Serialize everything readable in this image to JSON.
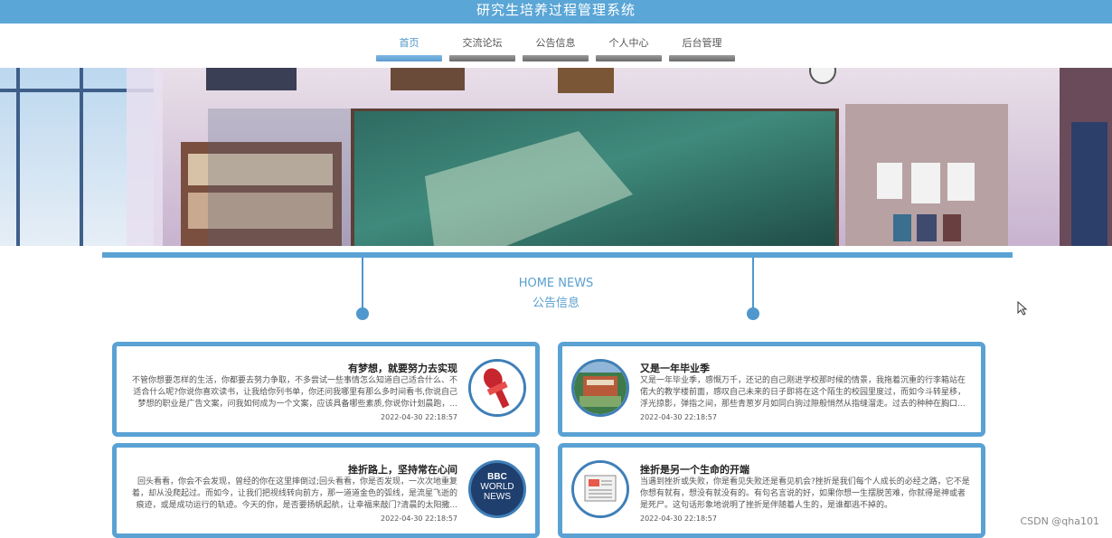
{
  "app": {
    "title": "研究生培养过程管理系统"
  },
  "nav": {
    "items": [
      {
        "label": "首页",
        "active": true
      },
      {
        "label": "交流论坛",
        "active": false
      },
      {
        "label": "公告信息",
        "active": false
      },
      {
        "label": "个人中心",
        "active": false
      },
      {
        "label": "后台管理",
        "active": false
      }
    ]
  },
  "section": {
    "title_en": "HOME NEWS",
    "title_cn": "公告信息"
  },
  "news": [
    {
      "title": "有梦想，就要努力去实现",
      "desc": "不管你想要怎样的生活，你都要去努力争取，不多尝试一些事情怎么知道自己适合什么、不适合什么呢?你说你喜欢读书，让我给你列书单，你还问我哪里有那么多时间看书,你说自己梦想的职业是广告文案，问我如何成为一个文案，应该具备哪些素质,你说你计划晨跑，...",
      "date": "2022-04-30 22:18:57",
      "icon": "microphone-icon"
    },
    {
      "title": "又是一年毕业季",
      "desc": "又是一年毕业季，感慨万千，还记的自己刚进学校那时候的情景，我拖着沉重的行李箱站在偌大的教学楼前面，感叹自己未来的日子即将在这个陌生的校园里度过，而如今斗转星移，浮光掠影，弹指之间，那些青葱岁月如同白驹过隙般悄然从指缝溜走。过去的种种在胸口...",
      "date": "2022-04-30 22:18:57",
      "icon": "campus-icon"
    },
    {
      "title": "挫折路上，坚持常在心间",
      "desc": "回头看看，你会不会发现，曾经的你在这里摔倒过;回头看看，你是否发现，一次次地重复着，却从没爬起过。而如今，让我们把视线转向前方，那一道道金色的弧线，是流星飞逝的痕迹，或是成功运行的轨迹。今天的你，是否要扬帆起航，让幸福来敲门?清晨的太阳撒...",
      "date": "2022-04-30 22:18:57",
      "icon": "bbc-news-icon",
      "icon_text": [
        "BBC",
        "WORLD",
        "NEWS"
      ]
    },
    {
      "title": "挫折是另一个生命的开端",
      "desc": "当遇到挫折或失败，你是看见失败还是看见机会?挫折是我们每个人成长的必经之路，它不是你想有就有，想没有就没有的。有句名言说的好，如果你想一生摆脱苦难，你就得是神或者是死尸。这句话形象地说明了挫折是伴随着人生的，是谁都逃不掉的。",
      "date": "2022-04-30 22:18:57",
      "icon": "newspaper-icon"
    }
  ],
  "watermark": "CSDN @qha101",
  "colors": {
    "accent": "#5aa2d4",
    "topbar": "#5aa6d6",
    "text_blue": "#5a9fcf"
  }
}
